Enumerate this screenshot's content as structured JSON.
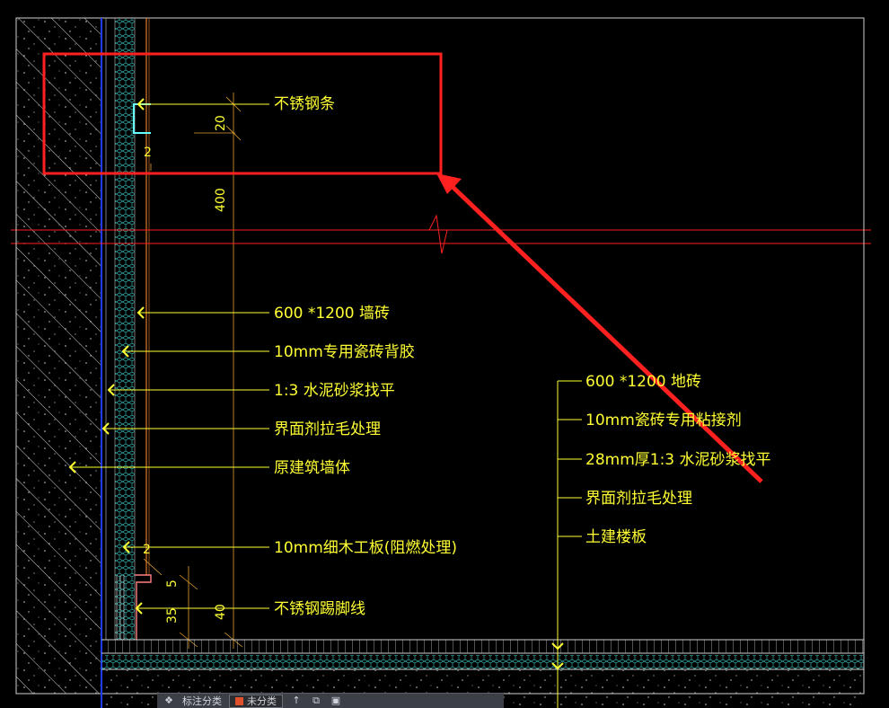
{
  "colors": {
    "annotation": "#ffff33",
    "highlight": "#ff2020",
    "hatch": "#d8d8d8",
    "mesh": "#3cc6c6",
    "wall_line": "#1e3cff",
    "guide": "#e07a2a"
  },
  "wall_labels": [
    "不锈钢条",
    "600 *1200 墙砖",
    "10mm专用瓷砖背胶",
    "1:3 水泥砂浆找平",
    "界面剂拉毛处理",
    "原建筑墙体",
    "10mm细木工板(阻燃处理)",
    "不锈钢踢脚线"
  ],
  "floor_labels": [
    "600 *1200 地砖",
    "10mm瓷砖专用粘接剂",
    "28mm厚1:3 水泥砂浆找平",
    "界面剂拉毛处理",
    "土建楼板"
  ],
  "dimensions": {
    "d20": "20",
    "d2_top": "2",
    "d400": "400",
    "d2_bottom": "2",
    "d5": "5",
    "d35": "35",
    "d40": "40"
  },
  "toolbar": {
    "layer_hint": "标注分类",
    "layer_name": "未分类",
    "icons": [
      "layers-icon",
      "arrow-up-icon",
      "copy-icon",
      "clipboard-icon"
    ]
  }
}
